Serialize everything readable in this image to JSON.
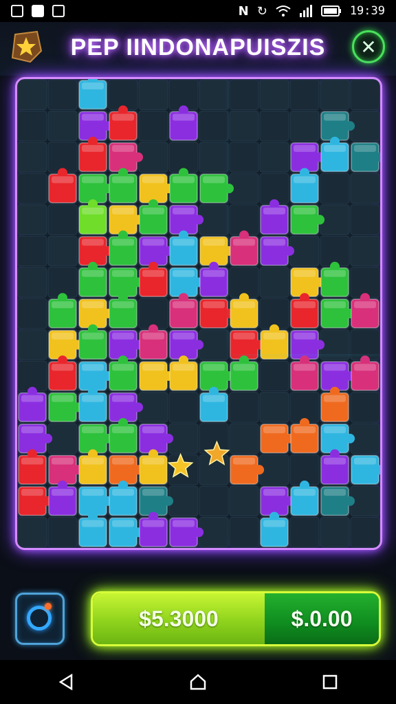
{
  "status_bar": {
    "time": "19:39",
    "left_icons": [
      "notification-icon",
      "message-icon",
      "gallery-icon"
    ],
    "right_icons": [
      "nfc-icon",
      "sync-icon",
      "wifi-icon",
      "signal-icon",
      "battery-icon"
    ]
  },
  "header": {
    "title": "PEP IINDONAPUISZIS",
    "badge_icon": "star-badge-icon",
    "close_icon": "close-icon"
  },
  "board": {
    "cols": 12,
    "rows": 15,
    "colors": {
      "R": "#e8262c",
      "G": "#2ec13c",
      "Y": "#f1c21d",
      "P": "#8b2ee0",
      "M": "#d8307a",
      "C": "#2fb6e0",
      "O": "#ef6a1f",
      "T": "#1f7f86",
      "L": "#6fdd2a"
    },
    "grid": [
      "..C.........",
      "..PR.P....T.",
      "..RM.....PCT",
      ".RGGYGG..C..",
      "..LYGP..PG..",
      "..RGPCYMP...",
      "..GGRCP..YG.",
      ".GYG.MRY.RGM",
      ".YGPMP.RYP..",
      ".RCGYYGG.MPM",
      "PGCP..C...O.",
      "P.GGP...OOC.",
      "RMYOY..O..PC",
      "RPCCT...PCT.",
      "..CCPP..C..."
    ]
  },
  "controls": {
    "tool_icon": "hint-ring-icon",
    "balance": "$5.3000",
    "win": "$.0.00"
  },
  "nav": {
    "back_icon": "back-triangle-icon",
    "home_icon": "home-icon",
    "recents_icon": "recents-square-icon"
  }
}
